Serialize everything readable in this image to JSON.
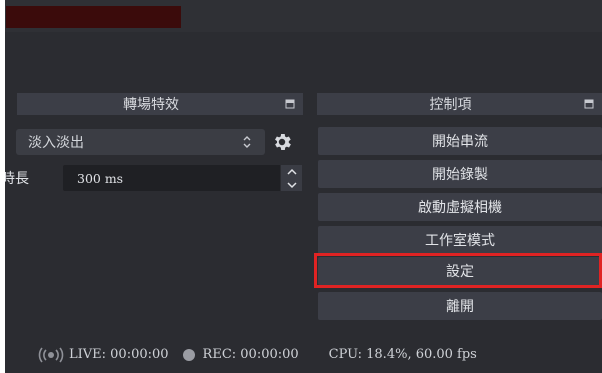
{
  "colors": {
    "app_bg": "#2b2c31",
    "dock_header_bg": "#3c3e47",
    "button_bg": "#3c3e47",
    "highlight": "#e02323",
    "text": "#e1e3e7"
  },
  "transitions_dock": {
    "title": "轉場特效",
    "transition_select": "淡入淡出",
    "duration_label": "時長",
    "duration_value": "300 ms",
    "icons": [
      "float-dock-icon",
      "chevron-updown-icon",
      "gear-icon",
      "spinner-up-icon",
      "spinner-down-icon"
    ]
  },
  "controls_dock": {
    "title": "控制項",
    "buttons": [
      {
        "label": "開始串流"
      },
      {
        "label": "開始錄製"
      },
      {
        "label": "啟動虛擬相機"
      },
      {
        "label": "工作室模式"
      },
      {
        "label": "設定",
        "highlighted": true
      },
      {
        "label": "離開"
      }
    ]
  },
  "status_bar": {
    "live": "LIVE: 00:00:00",
    "rec": "REC: 00:00:00",
    "cpu": "CPU: 18.4%, 60.00 fps",
    "icons": [
      "live-broadcast-icon",
      "rec-dot-icon"
    ]
  }
}
